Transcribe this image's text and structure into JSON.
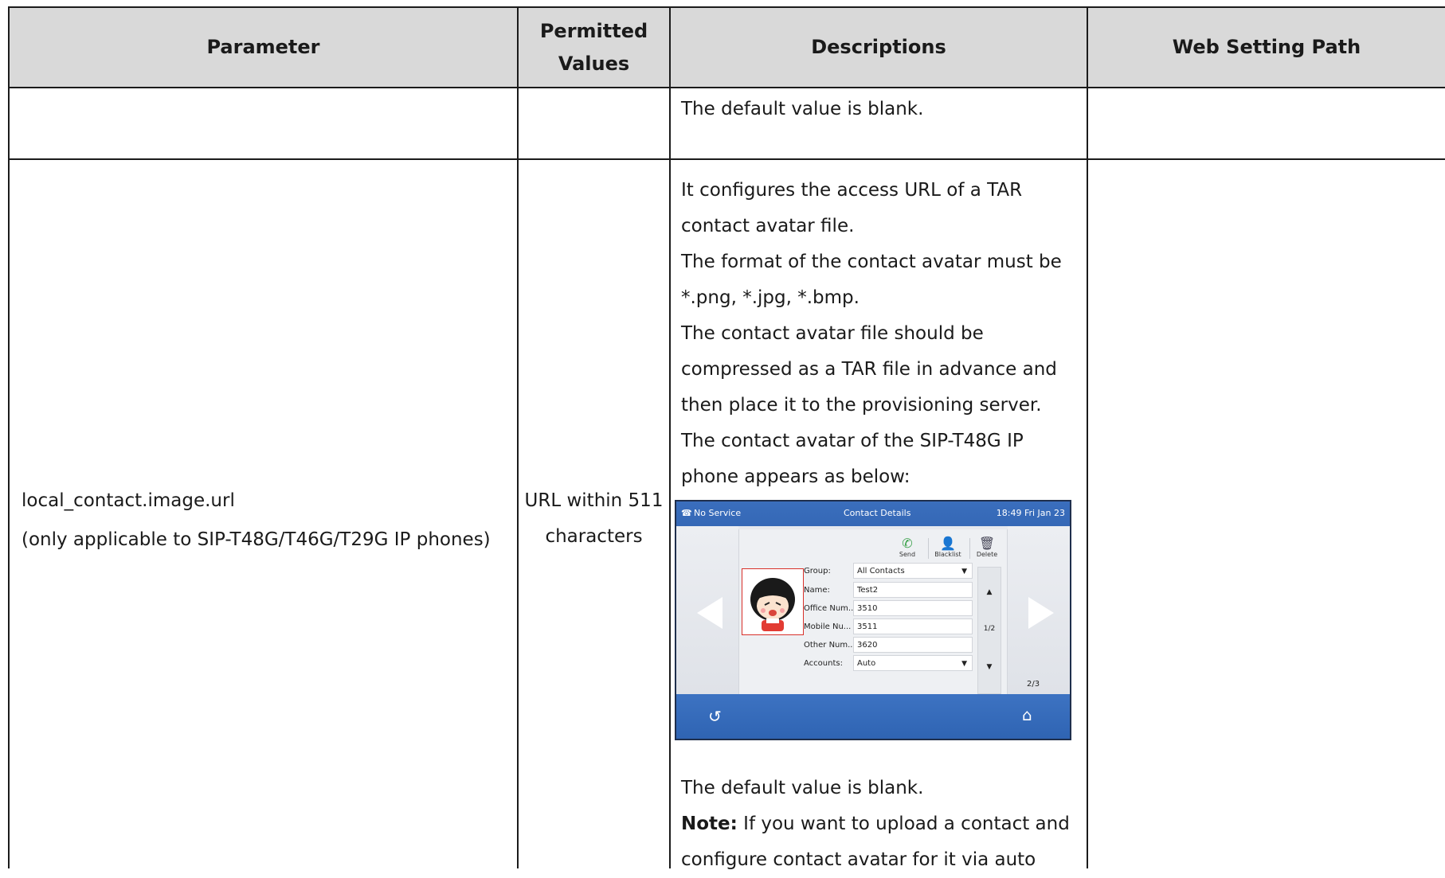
{
  "table": {
    "headers": [
      "Parameter",
      "Permitted Values",
      "Descriptions",
      "Web Setting Path"
    ],
    "header_lines": {
      "permitted_1": "Permitted",
      "permitted_2": "Values"
    },
    "rows": [
      {
        "parameter": "",
        "permitted": "",
        "description": [
          "The default value is blank."
        ],
        "web_path": ""
      },
      {
        "parameter_line1": "local_contact.image.url",
        "parameter_line2": "(only applicable to SIP-T48G/T46G/T29G IP phones)",
        "permitted_line1": "URL within 511",
        "permitted_line2": "characters",
        "description": [
          "It configures the access URL of a TAR contact avatar file.",
          "The format of the contact avatar must be *.png, *.jpg, *.bmp.",
          "The contact avatar file should be compressed as a TAR file in advance and then place it to the provisioning server.",
          "The contact avatar of the SIP-T48G IP phone appears as below:"
        ],
        "description_after": [
          "The default value is blank."
        ],
        "note_label": "Note:",
        "note_text": " If you want to upload a contact and configure contact avatar for it via auto",
        "web_path": ""
      }
    ]
  },
  "phone_screen": {
    "status_left": "No Service",
    "title": "Contact Details",
    "clock": "18:49 Fri Jan 23",
    "toolbar": [
      "Send",
      "Blacklist",
      "Delete"
    ],
    "fields": [
      {
        "label": "Group:",
        "value": "All Contacts",
        "dropdown": true
      },
      {
        "label": "Name:",
        "value": "Test2",
        "dropdown": false
      },
      {
        "label": "Office Num...",
        "value": "3510",
        "dropdown": false
      },
      {
        "label": "Mobile Nu...",
        "value": "3511",
        "dropdown": false
      },
      {
        "label": "Other Num...",
        "value": "3620",
        "dropdown": false
      },
      {
        "label": "Accounts:",
        "value": "Auto",
        "dropdown": true
      }
    ],
    "scroll_page": "1/2",
    "page_indicator": "2/3",
    "colors": {
      "bar": "#3568b6",
      "avatar_border": "#d8302a"
    }
  }
}
